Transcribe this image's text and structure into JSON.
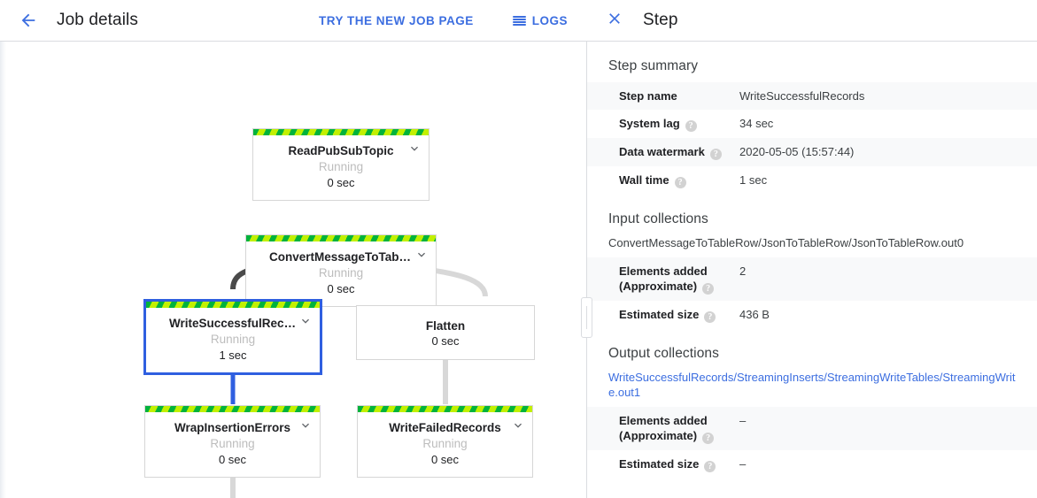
{
  "left": {
    "back_icon": "arrow-back-icon",
    "title": "Job details",
    "try_new_label": "TRY THE NEW JOB PAGE",
    "logs_label": "LOGS",
    "logs_icon": "list-icon"
  },
  "graph": {
    "nodes": [
      {
        "name": "ReadPubSubTopic",
        "status": "Running",
        "time": "0 sec",
        "striped": true,
        "selected": false,
        "chevron": true
      },
      {
        "name": "ConvertMessageToTabl…",
        "status": "Running",
        "time": "0 sec",
        "striped": true,
        "selected": false,
        "chevron": true
      },
      {
        "name": "WriteSuccessfulRecords",
        "status": "Running",
        "time": "1 sec",
        "striped": true,
        "selected": true,
        "chevron": true
      },
      {
        "name": "Flatten",
        "status": "",
        "time": "0 sec",
        "striped": false,
        "selected": false,
        "chevron": false
      },
      {
        "name": "WrapInsertionErrors",
        "status": "Running",
        "time": "0 sec",
        "striped": true,
        "selected": false,
        "chevron": true
      },
      {
        "name": "WriteFailedRecords",
        "status": "Running",
        "time": "0 sec",
        "striped": true,
        "selected": false,
        "chevron": true
      }
    ],
    "colors": {
      "stripe_green": "#00b33c",
      "stripe_yellow": "#c2f000",
      "selected_border": "#2f5fe0",
      "edge_default": "#d8d8d8",
      "edge_highlight": "#4a4a4a",
      "edge_selected": "#2f5fe0"
    }
  },
  "right": {
    "close_icon": "close-icon",
    "title": "Step",
    "step_summary": {
      "heading": "Step summary",
      "rows": [
        {
          "key": "Step name",
          "help": false,
          "value": "WriteSuccessfulRecords"
        },
        {
          "key": "System lag",
          "help": true,
          "value": "34 sec"
        },
        {
          "key": "Data watermark",
          "help": true,
          "value": "2020-05-05 (15:57:44)"
        },
        {
          "key": "Wall time",
          "help": true,
          "value": "1 sec"
        }
      ]
    },
    "input_collections": {
      "heading": "Input collections",
      "path": "ConvertMessageToTableRow/JsonToTableRow/JsonToTableRow.out0",
      "is_link": false,
      "rows": [
        {
          "key": "Elements added (Approximate)",
          "help": true,
          "value": "2"
        },
        {
          "key": "Estimated size",
          "help": true,
          "value": "436 B"
        }
      ]
    },
    "output_collections": {
      "heading": "Output collections",
      "path": "WriteSuccessfulRecords/StreamingInserts/StreamingWriteTables/StreamingWrite.out1",
      "is_link": true,
      "rows": [
        {
          "key": "Elements added (Approximate)",
          "help": true,
          "value": "–"
        },
        {
          "key": "Estimated size",
          "help": true,
          "value": "–"
        }
      ]
    },
    "help_glyph": "?"
  }
}
